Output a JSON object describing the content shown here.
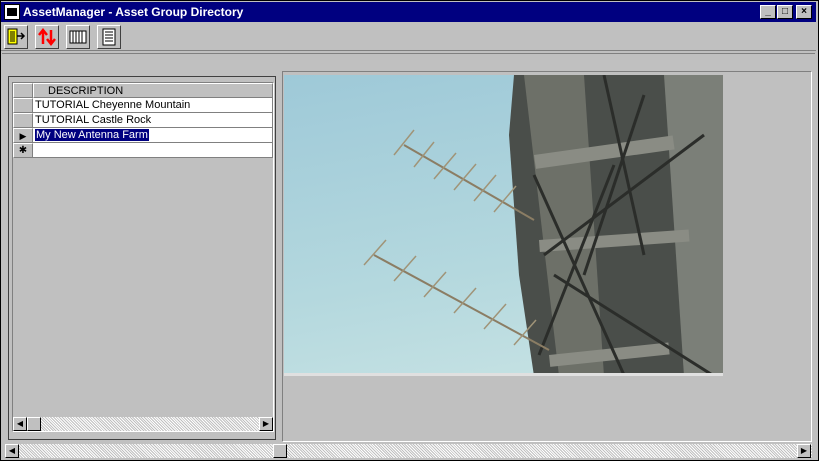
{
  "window": {
    "title": "AssetManager - Asset Group Directory",
    "controls": {
      "minimize": "_",
      "maximize": "□",
      "close": "×"
    }
  },
  "toolbar": {
    "buttons": [
      {
        "icon": "exit-door-icon"
      },
      {
        "icon": "sort-arrows-icon"
      },
      {
        "icon": "columns-icon"
      },
      {
        "icon": "form-view-icon"
      }
    ]
  },
  "grid": {
    "column_header": "DESCRIPTION",
    "rows": [
      {
        "description": "TUTORIAL Cheyenne Mountain",
        "indicator": ""
      },
      {
        "description": "TUTORIAL Castle Rock",
        "indicator": ""
      },
      {
        "description": "My New Antenna Farm",
        "indicator": "▶",
        "selected": true
      },
      {
        "description": "",
        "indicator": "✱"
      }
    ]
  },
  "image": {
    "subject": "antenna-tower-photo"
  },
  "colors": {
    "titlebar": "#000080",
    "selection": "#000080",
    "face": "#c0c0c0"
  }
}
